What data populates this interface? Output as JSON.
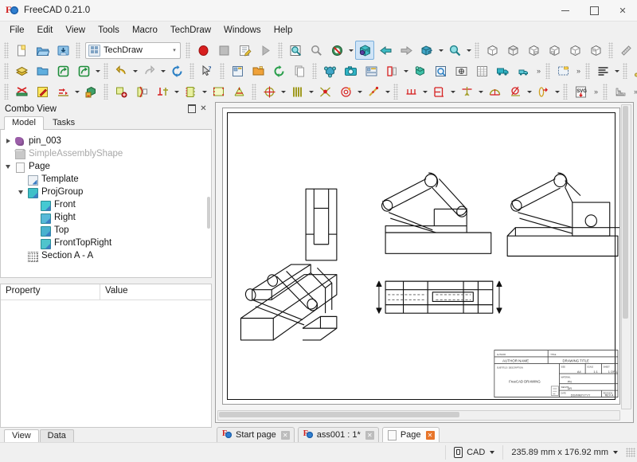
{
  "window": {
    "title": "FreeCAD 0.21.0",
    "app_icon": "freecad-logo-icon",
    "minimize_label": "Minimize",
    "maximize_label": "Maximize",
    "close_label": "Close"
  },
  "menubar": {
    "items": [
      {
        "label": "File",
        "name": "menu-file"
      },
      {
        "label": "Edit",
        "name": "menu-edit"
      },
      {
        "label": "View",
        "name": "menu-view"
      },
      {
        "label": "Tools",
        "name": "menu-tools"
      },
      {
        "label": "Macro",
        "name": "menu-macro"
      },
      {
        "label": "TechDraw",
        "name": "menu-techdraw"
      },
      {
        "label": "Windows",
        "name": "menu-windows"
      },
      {
        "label": "Help",
        "name": "menu-help"
      }
    ]
  },
  "workbench_selector": {
    "value": "TechDraw",
    "icon": "workbench-icon"
  },
  "toolbars": {
    "row1": [
      {
        "name": "new-document-button",
        "icon": "new-file-icon",
        "tip": "New"
      },
      {
        "name": "open-document-button",
        "icon": "open-folder-icon",
        "tip": "Open"
      },
      {
        "name": "save-document-button",
        "icon": "save-disk-icon",
        "tip": "Save"
      },
      {
        "name": "macro-record-button",
        "icon": "record-circle-icon",
        "tip": "Macro recording"
      },
      {
        "name": "macro-stop-button",
        "icon": "stop-square-icon",
        "tip": "Stop macro recording"
      },
      {
        "name": "macros-button",
        "icon": "macro-edit-icon",
        "tip": "Macros"
      },
      {
        "name": "macro-execute-button",
        "icon": "play-triangle-icon",
        "tip": "Execute macro"
      },
      {
        "name": "fit-all-button",
        "icon": "fit-all-icon",
        "tip": "Fit all"
      },
      {
        "name": "fit-selection-button",
        "icon": "fit-selection-icon",
        "tip": "Fit selection"
      },
      {
        "name": "draw-style-button",
        "icon": "draw-style-icon",
        "tip": "Draw style"
      },
      {
        "name": "isometric-view-button",
        "icon": "axonometric-cube-icon",
        "tip": "Isometric"
      },
      {
        "name": "view-back-button",
        "icon": "arrow-left-icon",
        "tip": "Back"
      },
      {
        "name": "view-forward-button",
        "icon": "arrow-right-icon",
        "tip": "Forward"
      },
      {
        "name": "axonometric-button",
        "icon": "axonometric-icon",
        "tip": "Axonometric"
      },
      {
        "name": "zoom-button",
        "icon": "magnifier-icon",
        "tip": "Zoom"
      },
      {
        "name": "front-view-button",
        "icon": "cube-front-icon",
        "tip": "Front"
      },
      {
        "name": "top-view-button",
        "icon": "cube-top-icon",
        "tip": "Top"
      },
      {
        "name": "right-view-button",
        "icon": "cube-right-icon",
        "tip": "Right"
      },
      {
        "name": "rear-view-button",
        "icon": "cube-rear-icon",
        "tip": "Rear"
      },
      {
        "name": "bottom-view-button",
        "icon": "cube-bottom-icon",
        "tip": "Bottom"
      },
      {
        "name": "left-view-button",
        "icon": "cube-left-icon",
        "tip": "Left"
      },
      {
        "name": "measure-button",
        "icon": "ruler-icon",
        "tip": "Measure"
      }
    ],
    "row2": [
      {
        "name": "std-workbench-button",
        "icon": "stack-yellow-icon"
      },
      {
        "name": "std-open-button",
        "icon": "folder-blue-icon"
      },
      {
        "name": "std-export-button",
        "icon": "export-arrow-icon"
      },
      {
        "name": "std-import-button",
        "icon": "import-arrow-icon"
      },
      {
        "name": "undo-button",
        "icon": "undo-arrow-icon"
      },
      {
        "name": "redo-button",
        "icon": "redo-arrow-icon"
      },
      {
        "name": "refresh-button",
        "icon": "refresh-icon"
      },
      {
        "name": "whats-this-button",
        "icon": "cursor-question-icon"
      },
      {
        "name": "std-view-screenshot-button",
        "icon": "window-icon"
      },
      {
        "name": "open-folder-button",
        "icon": "folder-open-icon"
      },
      {
        "name": "recompute-button",
        "icon": "recompute-icon"
      },
      {
        "name": "copy-button",
        "icon": "copy-pages-icon"
      },
      {
        "name": "navigation-cube-button",
        "icon": "nav-cube-icon"
      },
      {
        "name": "screenshot-button",
        "icon": "camera-icon"
      },
      {
        "name": "scene-inspector-button",
        "icon": "scene-inspector-icon"
      },
      {
        "name": "clipping-plane-button",
        "icon": "clip-plane-icon"
      },
      {
        "name": "texture-mapping-button",
        "icon": "texture-cube-icon"
      },
      {
        "name": "freeze-view-button",
        "icon": "freeze-view-icon"
      },
      {
        "name": "appearance-button",
        "icon": "appearance-icon"
      },
      {
        "name": "document-utility-button",
        "icon": "doc-grid-icon"
      },
      {
        "name": "units-calculator-button",
        "icon": "truck-icon"
      },
      {
        "name": "units-calculator-2-button",
        "icon": "truck-small-icon"
      },
      {
        "name": "page-insert-button",
        "icon": "page-new-icon"
      },
      {
        "name": "text-align-button",
        "icon": "text-lines-icon"
      },
      {
        "name": "bolt-button",
        "icon": "bolt-icon"
      }
    ],
    "row3": [
      {
        "name": "page-default-button",
        "icon": "page-default-icon"
      },
      {
        "name": "page-template-button",
        "icon": "page-template-icon"
      },
      {
        "name": "redraw-page-button",
        "icon": "redraw-page-icon"
      },
      {
        "name": "print-all-button",
        "icon": "print-pages-icon"
      },
      {
        "name": "view-insert-button",
        "icon": "insert-view-icon"
      },
      {
        "name": "broken-view-button",
        "icon": "broken-view-icon"
      },
      {
        "name": "active-view-button",
        "icon": "active-view-icon"
      },
      {
        "name": "projection-group-button",
        "icon": "proj-group-icon"
      },
      {
        "name": "spreadsheet-view-button",
        "icon": "spreadsheet-view-icon"
      },
      {
        "name": "section-view-button",
        "icon": "section-view-icon"
      },
      {
        "name": "complex-section-button",
        "icon": "complex-section-icon"
      },
      {
        "name": "detail-view-button",
        "icon": "detail-view-icon"
      },
      {
        "name": "clip-group-button",
        "icon": "clip-group-icon"
      },
      {
        "name": "hatch-face-button",
        "icon": "hatch-face-icon"
      },
      {
        "name": "length-dimension-button",
        "icon": "length-dim-icon"
      },
      {
        "name": "horizontal-dim-button",
        "icon": "horizontal-dim-icon"
      },
      {
        "name": "vertical-dim-button",
        "icon": "vertical-dim-icon"
      },
      {
        "name": "radius-dim-button",
        "icon": "radius-dim-icon"
      },
      {
        "name": "diameter-dim-button",
        "icon": "diameter-dim-icon"
      },
      {
        "name": "extension-line-button",
        "icon": "extension-line-icon"
      },
      {
        "name": "export-svg-button",
        "icon": "svg-export-icon"
      },
      {
        "name": "hatch-pattern-button",
        "icon": "hatch-pattern-icon"
      },
      {
        "name": "annotation-button",
        "icon": "annotation-a-icon"
      }
    ]
  },
  "combo_view": {
    "title": "Combo View",
    "float_label": "Float",
    "close_label": "Close",
    "tabs": [
      {
        "label": "Model",
        "name": "tab-model",
        "selected": true
      },
      {
        "label": "Tasks",
        "name": "tab-tasks",
        "selected": false
      }
    ],
    "tree": [
      {
        "label": "pin_003",
        "indent": 1,
        "arrow": "closed",
        "icon": "pin-solid-icon",
        "dim": false
      },
      {
        "label": "SimpleAssemblyShape",
        "indent": 1,
        "arrow": "none",
        "icon": "shape-solid-icon",
        "dim": true
      },
      {
        "label": "Page",
        "indent": 1,
        "arrow": "open",
        "icon": "page-icon",
        "dim": false
      },
      {
        "label": "Template",
        "indent": 2,
        "arrow": "none",
        "icon": "template-icon",
        "dim": false
      },
      {
        "label": "ProjGroup",
        "indent": 2,
        "arrow": "open",
        "icon": "projgroup-icon",
        "dim": false
      },
      {
        "label": "Front",
        "indent": 3,
        "arrow": "none",
        "icon": "view-front-icon",
        "dim": false
      },
      {
        "label": "Right",
        "indent": 3,
        "arrow": "none",
        "icon": "view-right-icon",
        "dim": false
      },
      {
        "label": "Top",
        "indent": 3,
        "arrow": "none",
        "icon": "view-top-icon",
        "dim": false
      },
      {
        "label": "FrontTopRight",
        "indent": 3,
        "arrow": "none",
        "icon": "view-isometric-icon",
        "dim": false
      },
      {
        "label": "Section A - A",
        "indent": 2,
        "arrow": "none",
        "icon": "section-icon",
        "dim": false
      }
    ]
  },
  "property_editor": {
    "columns": [
      "Property",
      "Value"
    ],
    "rows": [],
    "tabs": [
      {
        "label": "View",
        "name": "tab-view",
        "selected": true
      },
      {
        "label": "Data",
        "name": "tab-data",
        "selected": false
      }
    ]
  },
  "drawing_sheet": {
    "title_block": {
      "author_label": "AUTHOR NAME",
      "drawing_title_label": "DRAWING TITLE",
      "subtitle": "FreeCAD DRAWING",
      "date": "DD/MM/YYYY",
      "section_label": "A - A"
    }
  },
  "document_tabs": [
    {
      "label": "Start page",
      "name": "doc-tab-start-page",
      "icon": "freecad-logo-icon",
      "selected": false
    },
    {
      "label": "ass001 : 1*",
      "name": "doc-tab-ass001",
      "icon": "freecad-logo-icon",
      "selected": false
    },
    {
      "label": "Page",
      "name": "doc-tab-page",
      "icon": "page-icon",
      "selected": true
    }
  ],
  "statusbar": {
    "navigation_style": "CAD",
    "page_size": "235.89 mm x 176.92 mm"
  },
  "colors": {
    "accent": "#3d7ec4",
    "logo_red": "#d02020",
    "active_tab": "#e8762b",
    "teal": "#3fc0c8"
  }
}
